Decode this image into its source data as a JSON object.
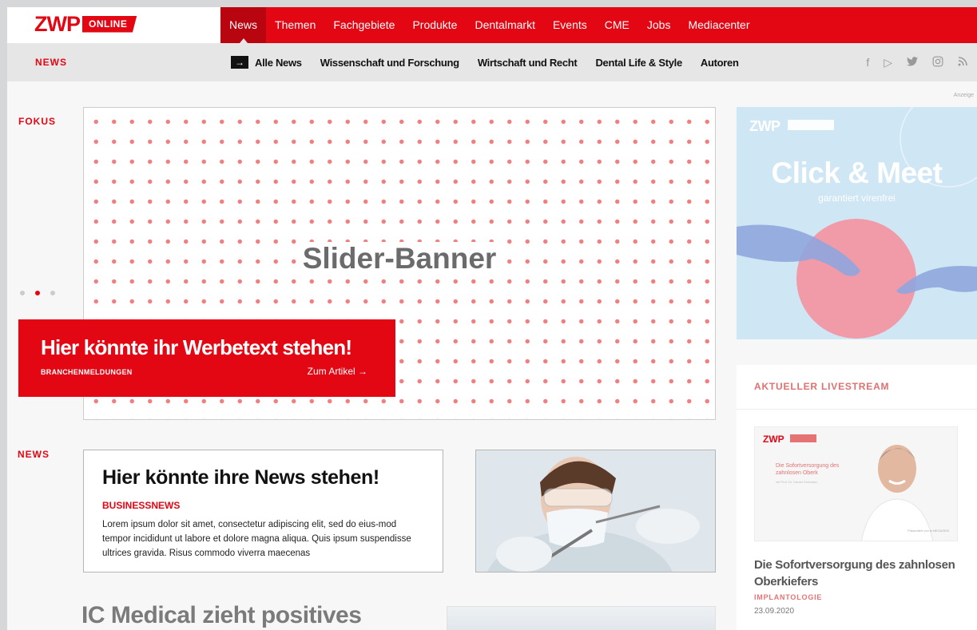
{
  "logo": {
    "zwp": "ZWP",
    "online": "ONLINE"
  },
  "main_nav": [
    {
      "label": "News",
      "active": true
    },
    {
      "label": "Themen"
    },
    {
      "label": "Fachgebiete"
    },
    {
      "label": "Produkte"
    },
    {
      "label": "Dentalmarkt"
    },
    {
      "label": "Events"
    },
    {
      "label": "CME"
    },
    {
      "label": "Jobs"
    },
    {
      "label": "Mediacenter"
    }
  ],
  "sub_nav": {
    "section": "NEWS",
    "items": [
      "Alle News",
      "Wissenschaft und Forschung",
      "Wirtschaft und Recht",
      "Dental Life & Style",
      "Autoren"
    ],
    "social": [
      "f",
      "▷",
      "🐦",
      "◎",
      "≋"
    ]
  },
  "fokus": {
    "label": "FOKUS",
    "slider_title": "Slider-Banner",
    "ad_headline": "Hier könnte ihr Werbetext stehen!",
    "ad_category": "BRANCHENMELDUNGEN",
    "ad_link": "Zum Artikel →"
  },
  "anzeige": "Anzeige",
  "news": {
    "label": "NEWS",
    "headline": "Hier könnte ihre News stehen!",
    "category": "BUSINESSNEWS",
    "text": "Lorem ipsum dolor sit amet, consectetur adipiscing elit, sed do eius-mod tempor incididunt ut labore et dolore magna aliqua. Quis ipsum suspendisse ultrices gravida. Risus commodo viverra maecenas",
    "next_headline": "IC Medical zieht positives"
  },
  "sidebar_ad": {
    "brand": "ZWP",
    "title": "Click & Meet",
    "subtitle": "garantiert virenfrei"
  },
  "livestream": {
    "label": "AKTUELLER LIVESTREAM",
    "thumb_brand": "ZWP",
    "thumb_text": "Die Sofortversorgung des zahnlosen Oberk",
    "thumb_small": "mit Prof. Dr. Daniel Grubeanu",
    "article_title": "Die Sofortversorgung des zahnlosen Oberkiefers",
    "category": "IMPLANTOLOGIE",
    "date": "23.09.2020"
  },
  "colors": {
    "brand_red": "#e30613",
    "subnav_bg": "#e6e6e6"
  }
}
